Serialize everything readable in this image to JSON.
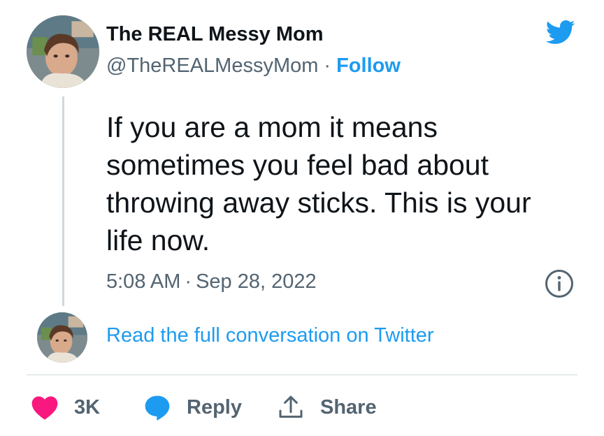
{
  "author": {
    "name": "The REAL Messy Mom",
    "handle": "@TheREALMessyMom",
    "separator": "·",
    "follow_label": "Follow"
  },
  "tweet": {
    "text": "If you are a mom it means\nsometimes you feel bad about\nthrowing away sticks. This is your\nlife now.",
    "time": "5:08 AM",
    "separator": "·",
    "date": "Sep 28, 2022"
  },
  "conversation": {
    "link_label": "Read the full conversation on Twitter"
  },
  "actions": {
    "likes_count": "3K",
    "reply_label": "Reply",
    "share_label": "Share"
  },
  "icons": {
    "brand": "twitter-bird-icon",
    "info": "info-icon",
    "like": "heart-icon",
    "reply": "speech-bubble-icon",
    "share": "share-upload-icon"
  },
  "colors": {
    "accent": "#1d9bf0",
    "heart": "#f91880",
    "secondary_text": "#536471",
    "border": "#cfd9de"
  }
}
